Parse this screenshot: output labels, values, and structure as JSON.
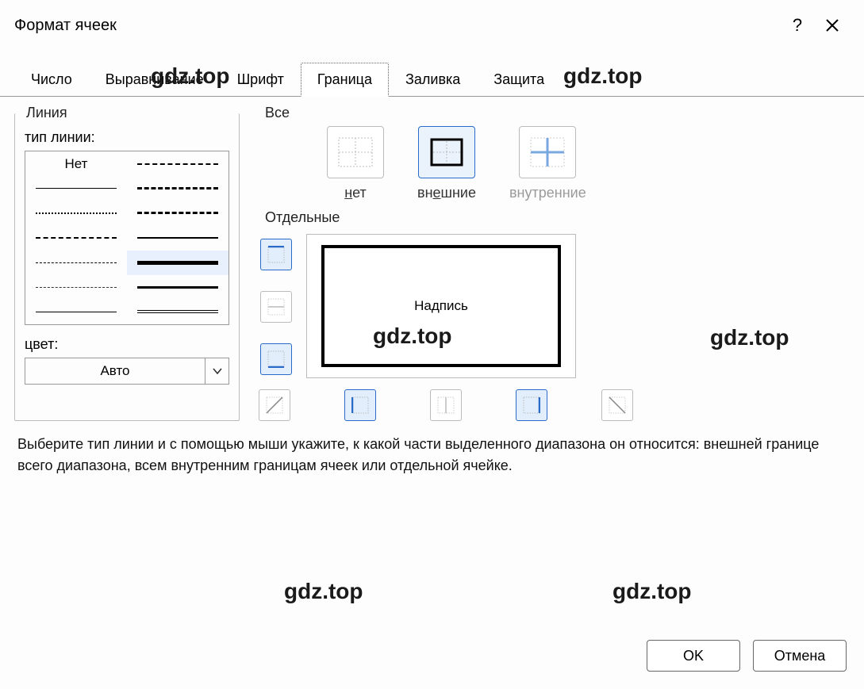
{
  "title": "Формат ячеек",
  "tabs": [
    "Число",
    "Выравнивание",
    "Шрифт",
    "Граница",
    "Заливка",
    "Защита"
  ],
  "active_tab": 3,
  "line": {
    "group_label": "Линия",
    "style_label": "тип линии:",
    "none_label": "Нет",
    "color_label": "цвет:",
    "color_value": "Авто"
  },
  "presets": {
    "group_label": "Все",
    "none": "нет",
    "outline": "внешние",
    "inside": "внутренние"
  },
  "individual": {
    "group_label": "Отдельные",
    "preview_text": "Надпись"
  },
  "help_text": "Выберите тип линии и с помощью мыши укажите, к какой части выделенного диапазона он относится: внешней границе всего диапазона, всем внутренним границам ячеек или отдельной ячейке.",
  "buttons": {
    "ok": "OK",
    "cancel": "Отмена"
  },
  "watermark": "gdz.top"
}
